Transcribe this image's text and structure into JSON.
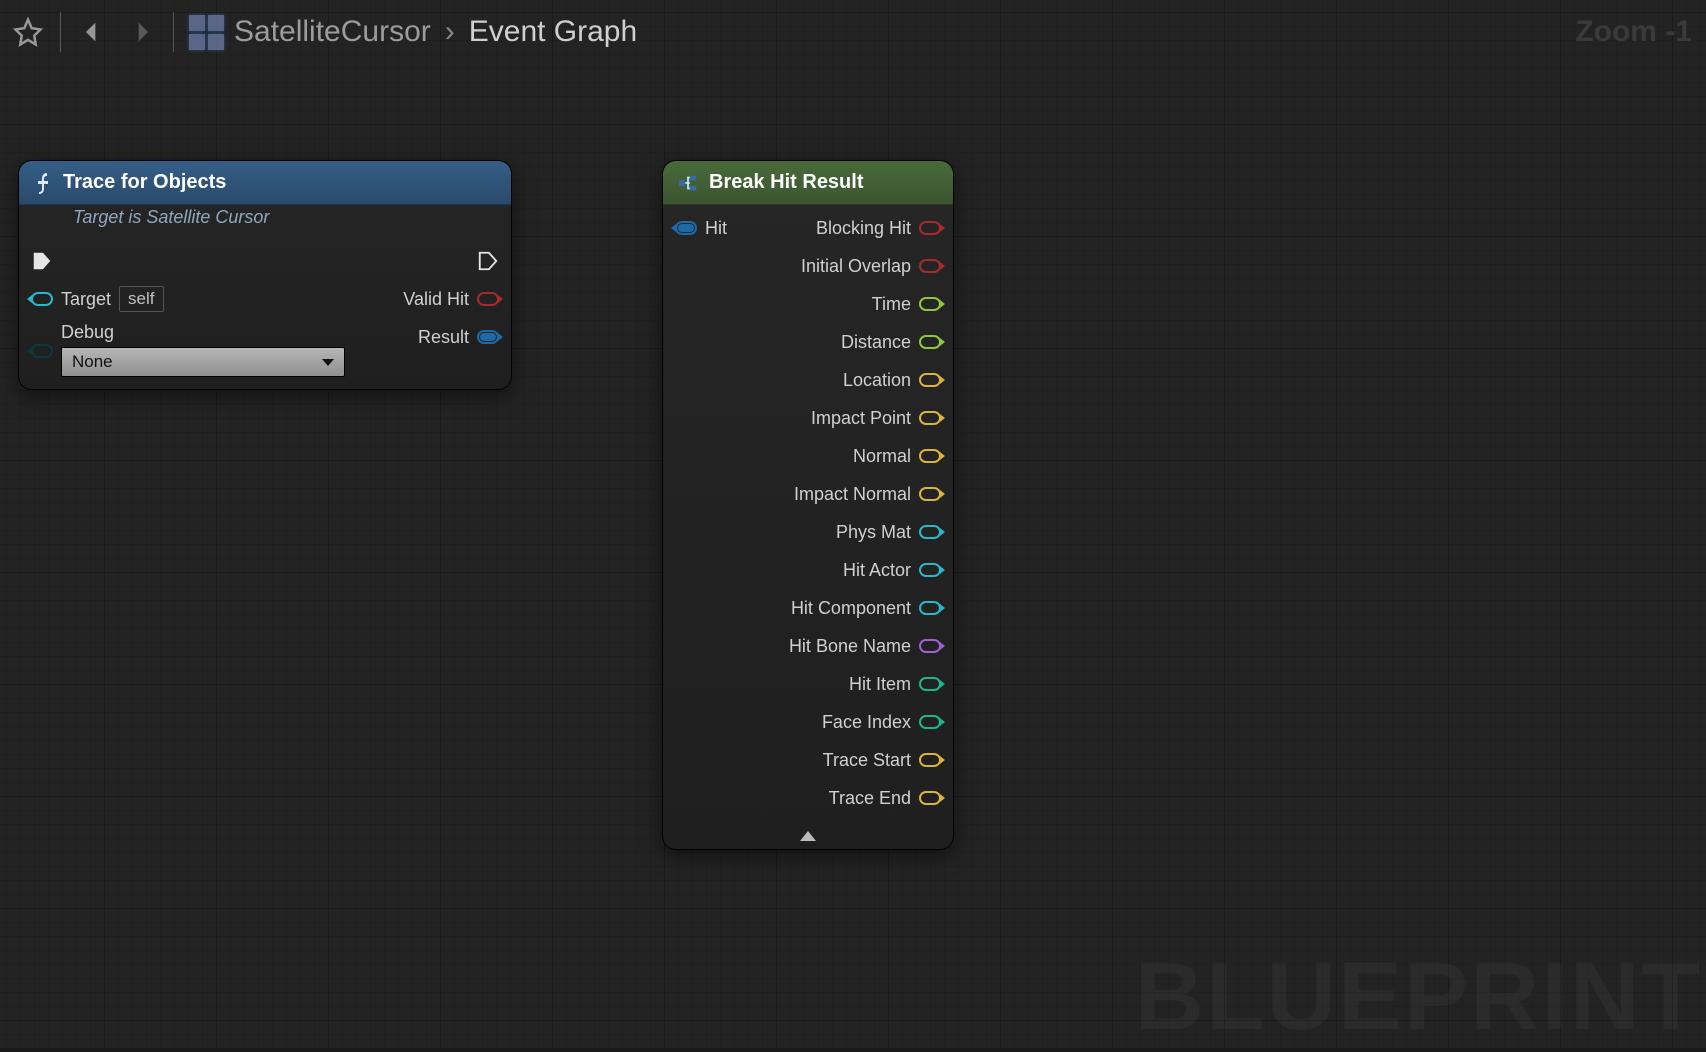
{
  "toolbar": {
    "breadcrumb_parent": "SatelliteCursor",
    "breadcrumb_current": "Event Graph",
    "zoom_label": "Zoom -1"
  },
  "watermark": "BLUEPRINT",
  "nodes": {
    "trace": {
      "title": "Trace for Objects",
      "subtitle": "Target is Satellite Cursor",
      "inputs": {
        "target_label": "Target",
        "target_value": "self",
        "debug_label": "Debug",
        "debug_value": "None"
      },
      "outputs": {
        "valid_hit": "Valid Hit",
        "result": "Result"
      }
    },
    "break": {
      "title": "Break Hit Result",
      "input_hit": "Hit",
      "outputs": [
        {
          "label": "Blocking Hit",
          "color": "c-red"
        },
        {
          "label": "Initial Overlap",
          "color": "c-red"
        },
        {
          "label": "Time",
          "color": "c-green"
        },
        {
          "label": "Distance",
          "color": "c-green"
        },
        {
          "label": "Location",
          "color": "c-yellow"
        },
        {
          "label": "Impact Point",
          "color": "c-yellow"
        },
        {
          "label": "Normal",
          "color": "c-yellow"
        },
        {
          "label": "Impact Normal",
          "color": "c-yellow"
        },
        {
          "label": "Phys Mat",
          "color": "c-cyan"
        },
        {
          "label": "Hit Actor",
          "color": "c-cyan"
        },
        {
          "label": "Hit Component",
          "color": "c-cyan"
        },
        {
          "label": "Hit Bone Name",
          "color": "c-purple"
        },
        {
          "label": "Hit Item",
          "color": "c-teal"
        },
        {
          "label": "Face Index",
          "color": "c-teal"
        },
        {
          "label": "Trace Start",
          "color": "c-yellow"
        },
        {
          "label": "Trace End",
          "color": "c-yellow"
        }
      ]
    }
  }
}
